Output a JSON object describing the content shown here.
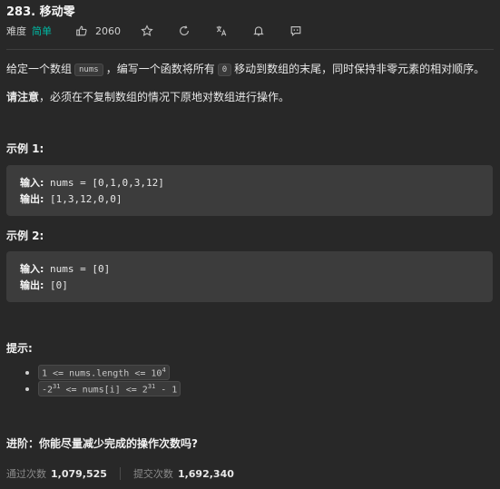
{
  "problem": {
    "title": "283. 移动零",
    "difficulty_label": "难度",
    "difficulty": "简单",
    "likes": "2060"
  },
  "description": {
    "line1_part1": "给定一个数组",
    "line1_code1": "nums",
    "line1_part2": "，编写一个函数将所有",
    "line1_code2": "0",
    "line1_part3": "移动到数组的末尾，同时保持非零元素的相对顺序。",
    "note_bold": "请注意",
    "note_rest": "，必须在不复制数组的情况下原地对数组进行操作。"
  },
  "examples": [
    {
      "heading": "示例 1:",
      "input_label": "输入:",
      "input_value": " nums = [0,1,0,3,12]",
      "output_label": "输出:",
      "output_value": " [1,3,12,0,0]"
    },
    {
      "heading": "示例 2:",
      "input_label": "输入:",
      "input_value": " nums = [0]",
      "output_label": "输出:",
      "output_value": " [0]"
    }
  ],
  "hints": {
    "heading": "提示:",
    "item1_text": "1 <= nums.length <= 10",
    "item1_sup": "4",
    "item2_a": "-2",
    "item2_a_sup": "31",
    "item2_b": " <= nums[i] <= 2",
    "item2_b_sup": "31",
    "item2_c": " - 1"
  },
  "advanced": {
    "text": "进阶：你能尽量减少完成的操作次数吗?"
  },
  "stats": {
    "accepted_label": "通过次数",
    "accepted_value": "1,079,525",
    "submissions_label": "提交次数",
    "submissions_value": "1,692,340"
  },
  "icons": {
    "like": "thumbs-up-icon",
    "favorite": "star-icon",
    "refresh": "refresh-icon",
    "translate": "translate-icon",
    "notify": "bell-icon",
    "feedback": "comment-icon"
  },
  "colors": {
    "background": "#282828",
    "easy": "#00b8a3",
    "code_block": "#3c3c3c"
  }
}
